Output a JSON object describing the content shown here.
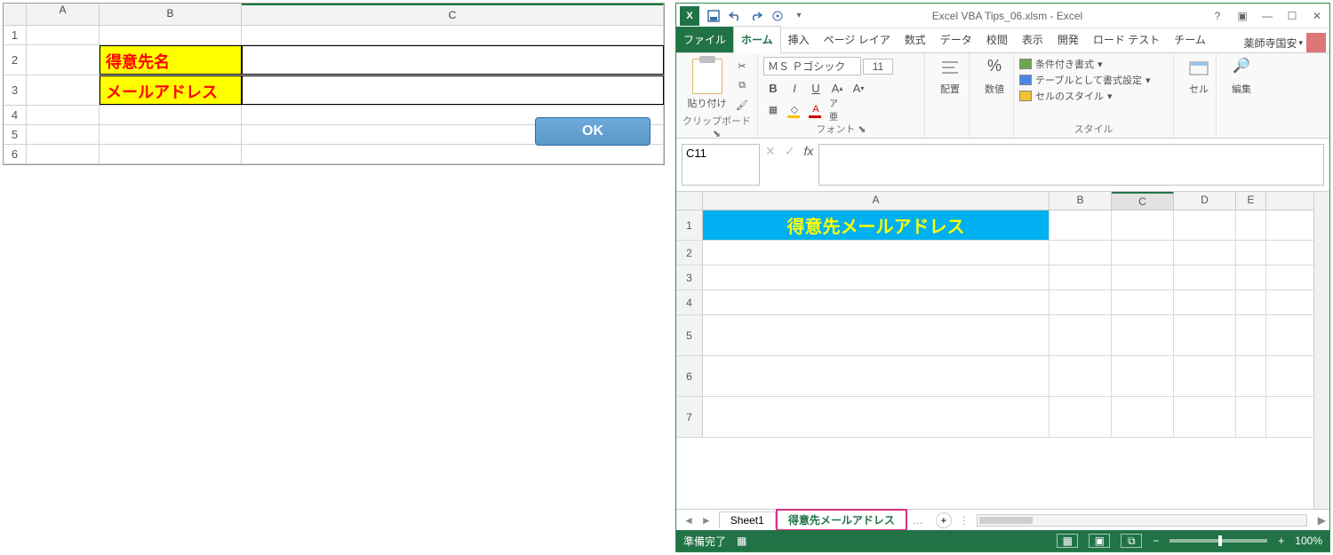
{
  "left": {
    "cols": [
      "A",
      "B",
      "C"
    ],
    "rows": [
      "1",
      "2",
      "3",
      "4",
      "5",
      "6"
    ],
    "labels": {
      "customer": "得意先名",
      "email": "メールアドレス"
    },
    "ok": "OK"
  },
  "title": "Excel VBA Tips_06.xlsm - Excel",
  "tabs": {
    "file": "ファイル",
    "home": "ホーム",
    "insert": "挿入",
    "layout": "ページ レイア",
    "formula": "数式",
    "data": "データ",
    "review": "校閲",
    "view": "表示",
    "dev": "開発",
    "load": "ロード テスト",
    "team": "チーム"
  },
  "account": "薬師寺国安",
  "ribbon": {
    "paste": "貼り付け",
    "clipboard": "クリップボード",
    "font_name": "ＭＳ Ｐゴシック",
    "font_size": "11",
    "font": "フォント",
    "align": "配置",
    "number": "数値",
    "cond": "条件付き書式",
    "table": "テーブルとして書式設定",
    "cellstyle": "セルのスタイル",
    "styles": "スタイル",
    "cells": "セル",
    "editing": "編集",
    "ruby": "ア亜"
  },
  "namebox": "C11",
  "sheet": {
    "cols": [
      "A",
      "B",
      "C",
      "D",
      "E"
    ],
    "rows": [
      "1",
      "2",
      "3",
      "4",
      "5",
      "6",
      "7"
    ],
    "header": "得意先メールアドレス",
    "tab1": "Sheet1",
    "tab2": "得意先メールアドレス"
  },
  "status": {
    "ready": "準備完了",
    "zoom": "100%"
  }
}
